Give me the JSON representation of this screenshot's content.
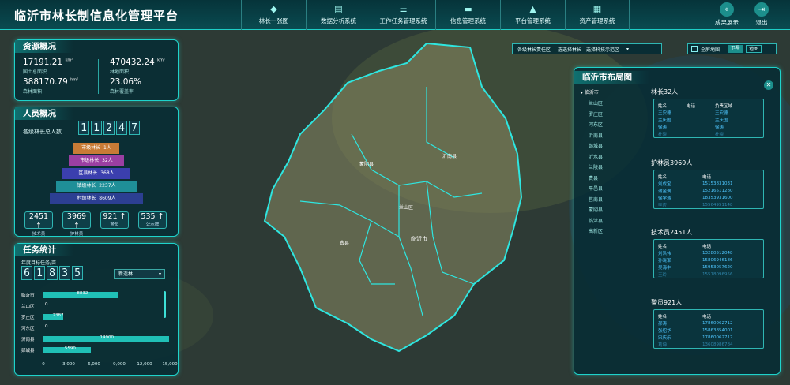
{
  "app": {
    "title": "临沂市林长制信息化管理平台"
  },
  "nav": [
    {
      "label": "林长一张图",
      "icon": "map-pin-icon"
    },
    {
      "label": "数据分析系统",
      "icon": "chart-icon"
    },
    {
      "label": "工作任务管理系统",
      "icon": "tasks-icon"
    },
    {
      "label": "信息管理系统",
      "icon": "folder-icon"
    },
    {
      "label": "平台管理系统",
      "icon": "network-icon"
    },
    {
      "label": "资产管理系统",
      "icon": "assets-icon"
    }
  ],
  "header_buttons": {
    "showcase": "成果展示",
    "exit": "退出"
  },
  "resources": {
    "title": "资源概况",
    "items": [
      {
        "value": "17191.21",
        "unit": "km²",
        "label": "国土总面积"
      },
      {
        "value": "470432.24",
        "unit": "km²",
        "label": "林地面积"
      },
      {
        "value": "388170.79",
        "unit": "hm²",
        "label": "森林面积"
      },
      {
        "value": "23.06%",
        "unit": "",
        "label": "森林覆盖率"
      }
    ]
  },
  "people": {
    "title": "人员概况",
    "total_label": "各级林长总人数",
    "digits": [
      "1",
      "1",
      "2",
      "4",
      "7"
    ],
    "levels": [
      {
        "label": "市级林长",
        "count": "1人",
        "color": "#c87b36"
      },
      {
        "label": "市级林长",
        "count": "32人",
        "color": "#9b3fa2"
      },
      {
        "label": "区县林长",
        "count": "368人",
        "color": "#3b3fae"
      },
      {
        "label": "镇级林长",
        "count": "2237人",
        "color": "#1f8f98"
      },
      {
        "label": "村级林长",
        "count": "8609人",
        "color": "#2c3f92"
      }
    ],
    "stats": [
      {
        "num": "2451",
        "label": "技术员"
      },
      {
        "num": "3969",
        "label": "护林员"
      },
      {
        "num": "921",
        "label": "警员"
      },
      {
        "num": "535",
        "label": "公示牌"
      }
    ]
  },
  "tasks": {
    "title": "任务统计",
    "subtitle": "年度目标任务/亩",
    "digits": [
      "6",
      "1",
      "8",
      "3",
      "5"
    ],
    "select_value": "新造林",
    "chart_data": {
      "type": "bar",
      "orientation": "horizontal",
      "categories": [
        "临沂市",
        "兰山区",
        "罗庄区",
        "河东区",
        "沂南县",
        "郯城县"
      ],
      "values": [
        8832,
        0,
        2387,
        0,
        14900,
        5590
      ],
      "xlim": [
        0,
        15000
      ],
      "xticks": [
        "0",
        "3,000",
        "6,000",
        "9,000",
        "12,000",
        "15,000"
      ]
    }
  },
  "map_controls": {
    "area_label": "各级林长责任区",
    "select_linzhang": "选选择林长",
    "select_demo": "选择科技示范区",
    "full_map": "全屏地图",
    "toggle_sat": "卫星",
    "toggle_map": "地图"
  },
  "layout_panel": {
    "title": "临沂市布局图",
    "tree_root": "临沂市",
    "tree": [
      "兰山区",
      "罗庄区",
      "河东区",
      "沂南县",
      "郯城县",
      "沂水县",
      "兰陵县",
      "费县",
      "平邑县",
      "莒南县",
      "蒙阴县",
      "临沭县",
      "高新区"
    ],
    "groups": [
      {
        "title": "林长32人",
        "headers": [
          "姓名",
          "电话",
          "负责区域"
        ],
        "rows": [
          [
            "王安德",
            "",
            "王安德"
          ],
          [
            "孟庆国",
            "",
            "孟庆国"
          ],
          [
            "徐涛",
            "",
            "徐涛"
          ],
          [
            "杜晓",
            "",
            "杜晓"
          ]
        ]
      },
      {
        "title": "护林员3969人",
        "headers": [
          "姓名",
          "电话"
        ],
        "rows": [
          [
            "刘成宝",
            "15153831031"
          ],
          [
            "谢金满",
            "15216511280"
          ],
          [
            "徐学涛",
            "18353931600"
          ],
          [
            "李应",
            "15564951148"
          ]
        ]
      },
      {
        "title": "技术员2451人",
        "headers": [
          "姓名",
          "电话"
        ],
        "rows": [
          [
            "刘洪伟",
            "13280512048"
          ],
          [
            "孙晓军",
            "15806946186"
          ],
          [
            "吴海丰",
            "15953057620"
          ],
          [
            "王玲",
            "15518096956"
          ]
        ]
      },
      {
        "title": "警员921人",
        "headers": [
          "姓名",
          "电话"
        ],
        "rows": [
          [
            "郝涛",
            "17860062712"
          ],
          [
            "张绍华",
            "15863854001"
          ],
          [
            "宋庆乐",
            "17860062717"
          ],
          [
            "葛坤",
            "13608986784"
          ]
        ]
      }
    ]
  },
  "map_labels": [
    "临沂市",
    "蒙阴县",
    "沂南县",
    "费县",
    "兰山区"
  ],
  "colors": {
    "accent": "#1ed3cb",
    "panel_bg": "#062c34",
    "bar": "#20c0b6",
    "link": "#4fc6ff"
  }
}
